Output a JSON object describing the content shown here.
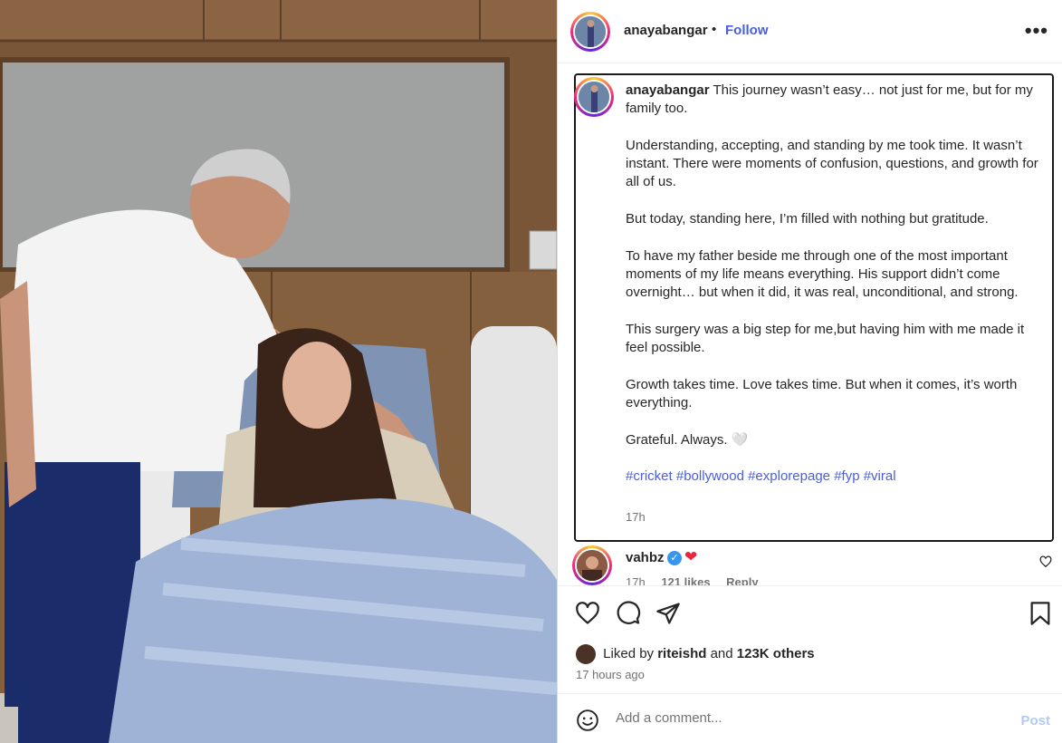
{
  "post": {
    "username": "anayabangar",
    "dot": "•",
    "follow_label": "Follow",
    "more_icon": "more-options-icon"
  },
  "caption": {
    "username": "anayabangar",
    "paragraphs": [
      "This journey wasn’t easy… not just for me, but for my family too.",
      "Understanding, accepting, and standing by me took time. It wasn’t instant. There were moments of confusion, questions, and growth for all of us.",
      "But today, standing here, I’m filled with nothing but gratitude.",
      "To have my father beside me through one of the most important moments of my life means everything. His support didn’t come overnight… but when it did, it was real, unconditional, and strong.",
      "This surgery was a big step for me,but having him with me made it feel possible.",
      "Growth takes time. Love takes time. But when it comes, it’s worth everything.",
      "Grateful. Always. 🤍"
    ],
    "hashtags": [
      "#cricket",
      "#bollywood",
      "#explorepage",
      "#fyp",
      "#viral"
    ],
    "time": "17h"
  },
  "comment": {
    "username": "vahbz",
    "text": "❤",
    "time": "17h",
    "likes": "121 likes",
    "reply": "Reply"
  },
  "engagement": {
    "liked_prefix": "Liked by",
    "liked_user": "riteishd",
    "liked_and": "and",
    "liked_others": "123K others",
    "posted": "17 hours ago"
  },
  "add_comment": {
    "placeholder": "Add a comment...",
    "post_label": "Post"
  },
  "colors": {
    "link": "#4a5fd9",
    "verified": "#3797f0",
    "post_disabled": "#b3c9f5"
  }
}
